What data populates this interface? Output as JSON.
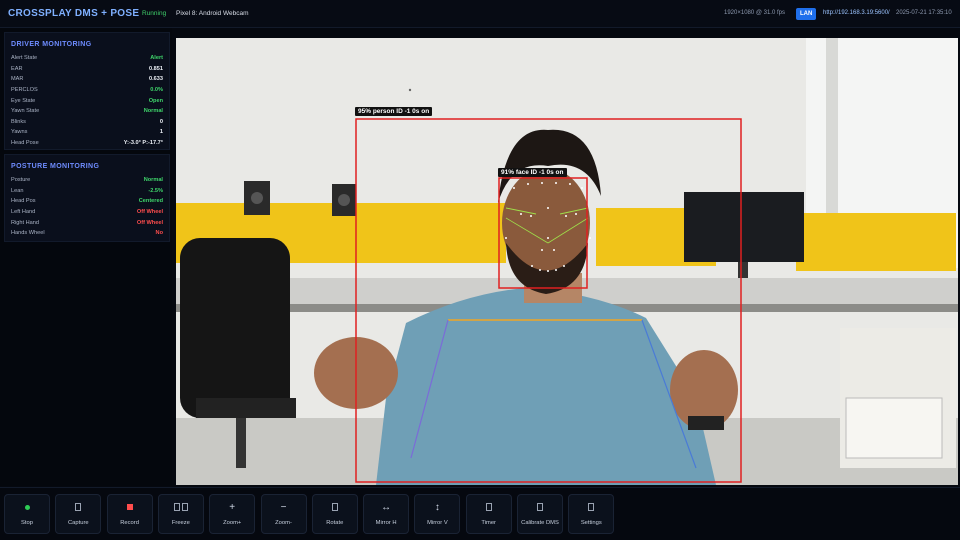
{
  "app": {
    "title": "CROSSPLAY DMS + POSE",
    "status": "Running",
    "device": "Pixel 8: Android Webcam",
    "resolution": "1920×1080 @ 31.0 fps",
    "lan_badge": "LAN",
    "url": "http://192.168.3.19:5600/",
    "datetime": "2025-07-21 17:35:10"
  },
  "driver_monitoring": {
    "title": "DRIVER MONITORING",
    "rows": [
      {
        "label": "Alert State",
        "value": "Alert",
        "tone": "green"
      },
      {
        "label": "EAR",
        "value": "0.851",
        "tone": "white"
      },
      {
        "label": "MAR",
        "value": "0.633",
        "tone": "white"
      },
      {
        "label": "PERCLOS",
        "value": "0.0%",
        "tone": "green"
      },
      {
        "label": "Eye State",
        "value": "Open",
        "tone": "green"
      },
      {
        "label": "Yawn State",
        "value": "Normal",
        "tone": "green"
      },
      {
        "label": "Blinks",
        "value": "0",
        "tone": "white"
      },
      {
        "label": "Yawns",
        "value": "1",
        "tone": "white"
      },
      {
        "label": "Head Pose",
        "value": "Y:-3.0° P:-17.7°",
        "tone": "white"
      }
    ]
  },
  "posture_monitoring": {
    "title": "POSTURE MONITORING",
    "rows": [
      {
        "label": "Posture",
        "value": "Normal",
        "tone": "green"
      },
      {
        "label": "Lean",
        "value": "-2.5%",
        "tone": "green"
      },
      {
        "label": "Head Pos",
        "value": "Centered",
        "tone": "green"
      },
      {
        "label": "Left Hand",
        "value": "Off Wheel",
        "tone": "red"
      },
      {
        "label": "Right Hand",
        "value": "Off Wheel",
        "tone": "red"
      },
      {
        "label": "Hands Wheel",
        "value": "No",
        "tone": "red"
      }
    ]
  },
  "detections": {
    "person_label": "95% person ID -1 0s on",
    "face_label": "91% face ID -1 0s on"
  },
  "toolbar": [
    {
      "label": "Stop",
      "icon": "stop-dot-icon"
    },
    {
      "label": "Capture",
      "icon": "capture-icon"
    },
    {
      "label": "Record",
      "icon": "record-icon"
    },
    {
      "label": "Freeze",
      "icon": "freeze-icon"
    },
    {
      "label": "Zoom+",
      "icon": "zoom-in-icon",
      "glyph": "+"
    },
    {
      "label": "Zoom-",
      "icon": "zoom-out-icon",
      "glyph": "−"
    },
    {
      "label": "Rotate",
      "icon": "rotate-icon"
    },
    {
      "label": "Mirror H",
      "icon": "mirror-h-icon",
      "glyph": "↔"
    },
    {
      "label": "Mirror V",
      "icon": "mirror-v-icon",
      "glyph": "↕"
    },
    {
      "label": "Timer",
      "icon": "timer-icon"
    },
    {
      "label": "Calibrate DMS",
      "icon": "calibrate-icon"
    },
    {
      "label": "Settings",
      "icon": "settings-icon"
    }
  ],
  "colors": {
    "accent": "#7fb0ff",
    "ok": "#3fd66b",
    "alert": "#ff4d4d",
    "box": "#e02020"
  }
}
